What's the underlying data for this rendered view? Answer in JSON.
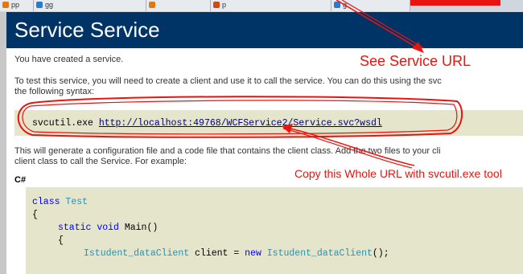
{
  "browser": {
    "tabs": [
      {
        "label": "pp",
        "color": "#e07a10"
      },
      {
        "label": "gg",
        "color": "#2a7bd0"
      },
      {
        "label": "",
        "color": "#e07a10"
      },
      {
        "label": "p",
        "color": "#d04a10"
      },
      {
        "label": "g",
        "color": "#2a7bd0"
      }
    ]
  },
  "page": {
    "title": "Service Service",
    "line1": "You have created a service.",
    "line2a": "To test this service, you will need to create a client and use it to call the service. You can do this using the svc",
    "line2b": "the following syntax:",
    "cmd_exe": "svcutil.exe",
    "cmd_url": "http://localhost:49768/WCFService2/Service.svc?wsdl",
    "line3a": "This will generate a configuration file and a code file that contains the client class. Add the two files to your cli",
    "line3b": "client class to call the Service. For example:",
    "lang_label": "C#",
    "code": {
      "l1_kw": "class",
      "l1_type": "Test",
      "l2": "{",
      "l3_kw": "static",
      "l3_kw2": "void",
      "l3_rest": "Main()",
      "l4": "{",
      "l5_type": "Istudent_dataClient",
      "l5_mid": "client =",
      "l5_kw": "new",
      "l5_type2": "Istudent_dataClient",
      "l5_end": "();"
    }
  },
  "annotations": {
    "see_url": "See Service URL",
    "copy_url": "Copy this Whole URL with svcutil.exe tool",
    "color": "#e8140f"
  }
}
